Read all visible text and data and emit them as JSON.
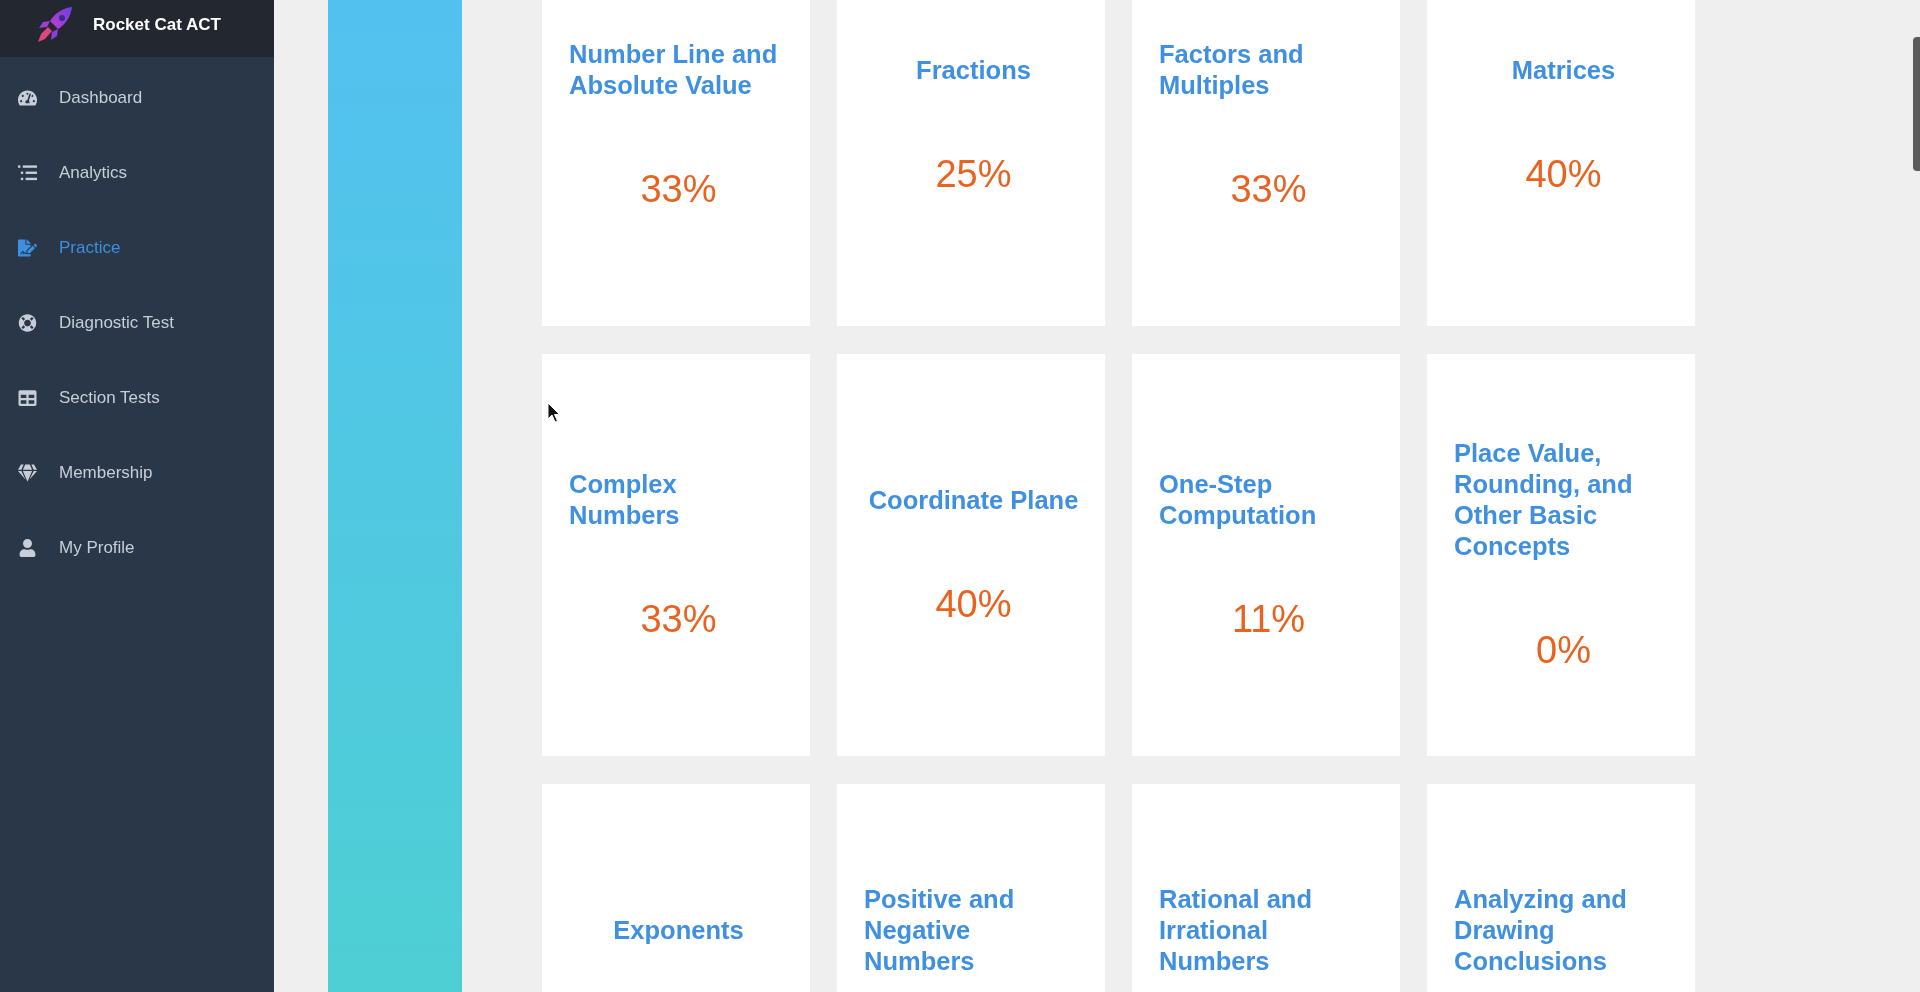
{
  "sidebar": {
    "brand": "Rocket Cat ACT",
    "items": [
      {
        "label": "Dashboard",
        "selected": false
      },
      {
        "label": "Analytics",
        "selected": false
      },
      {
        "label": "Practice",
        "selected": true
      },
      {
        "label": "Diagnostic Test",
        "selected": false
      },
      {
        "label": "Section Tests",
        "selected": false
      },
      {
        "label": "Membership",
        "selected": false
      },
      {
        "label": "My Profile",
        "selected": false
      }
    ]
  },
  "cards": [
    {
      "title": "Number Line and Absolute Value",
      "score": "33%"
    },
    {
      "title": "Fractions",
      "score": "25%"
    },
    {
      "title": "Factors and Multiples",
      "score": "33%"
    },
    {
      "title": "Matrices",
      "score": "40%"
    },
    {
      "title": "Complex Numbers",
      "score": "33%"
    },
    {
      "title": "Coordinate Plane",
      "score": "40%"
    },
    {
      "title": "One-Step Computation",
      "score": "11%"
    },
    {
      "title": "Place Value, Rounding, and Other Basic Concepts",
      "score": "0%"
    },
    {
      "title": "Exponents"
    },
    {
      "title": "Positive and Negative Numbers"
    },
    {
      "title": "Rational and Irrational Numbers"
    },
    {
      "title": "Analyzing and Drawing Conclusions"
    }
  ]
}
